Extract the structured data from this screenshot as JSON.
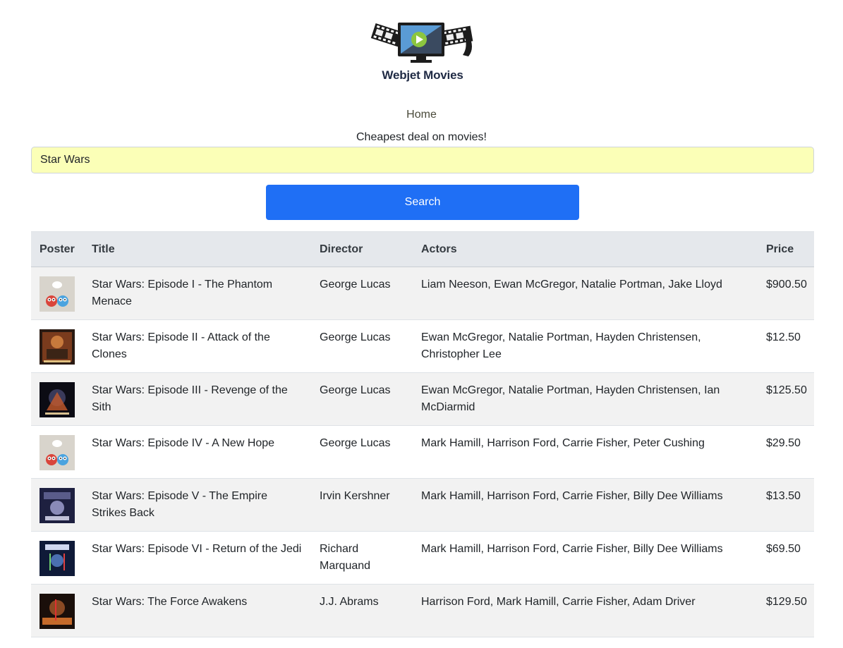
{
  "brand": {
    "name": "Webjet Movies"
  },
  "nav": {
    "home_label": "Home"
  },
  "tagline": "Cheapest deal on movies!",
  "search": {
    "value": "Star Wars",
    "button_label": "Search"
  },
  "table": {
    "headers": {
      "poster": "Poster",
      "title": "Title",
      "director": "Director",
      "actors": "Actors",
      "price": "Price"
    },
    "rows": [
      {
        "poster": "placeholder-birds",
        "title": "Star Wars: Episode I - The Phantom Menace",
        "director": "George Lucas",
        "actors": "Liam Neeson, Ewan McGregor, Natalie Portman, Jake Lloyd",
        "price": "$900.50"
      },
      {
        "poster": "poster-episode-2",
        "title": "Star Wars: Episode II - Attack of the Clones",
        "director": "George Lucas",
        "actors": "Ewan McGregor, Natalie Portman, Hayden Christensen, Christopher Lee",
        "price": "$12.50"
      },
      {
        "poster": "poster-episode-3",
        "title": "Star Wars: Episode III - Revenge of the Sith",
        "director": "George Lucas",
        "actors": "Ewan McGregor, Natalie Portman, Hayden Christensen, Ian McDiarmid",
        "price": "$125.50"
      },
      {
        "poster": "placeholder-birds",
        "title": "Star Wars: Episode IV - A New Hope",
        "director": "George Lucas",
        "actors": "Mark Hamill, Harrison Ford, Carrie Fisher, Peter Cushing",
        "price": "$29.50"
      },
      {
        "poster": "poster-episode-5",
        "title": "Star Wars: Episode V - The Empire Strikes Back",
        "director": "Irvin Kershner",
        "actors": "Mark Hamill, Harrison Ford, Carrie Fisher, Billy Dee Williams",
        "price": "$13.50"
      },
      {
        "poster": "poster-episode-6",
        "title": "Star Wars: Episode VI - Return of the Jedi",
        "director": "Richard Marquand",
        "actors": "Mark Hamill, Harrison Ford, Carrie Fisher, Billy Dee Williams",
        "price": "$69.50"
      },
      {
        "poster": "poster-force-awakens",
        "title": "Star Wars: The Force Awakens",
        "director": "J.J. Abrams",
        "actors": "Harrison Ford, Mark Hamill, Carrie Fisher, Adam Driver",
        "price": "$129.50"
      }
    ]
  },
  "colors": {
    "search_bg": "#fbffb7",
    "button_bg": "#1f6ff5",
    "header_bg": "#e5e8ec",
    "stripe_bg": "#f2f2f2"
  }
}
